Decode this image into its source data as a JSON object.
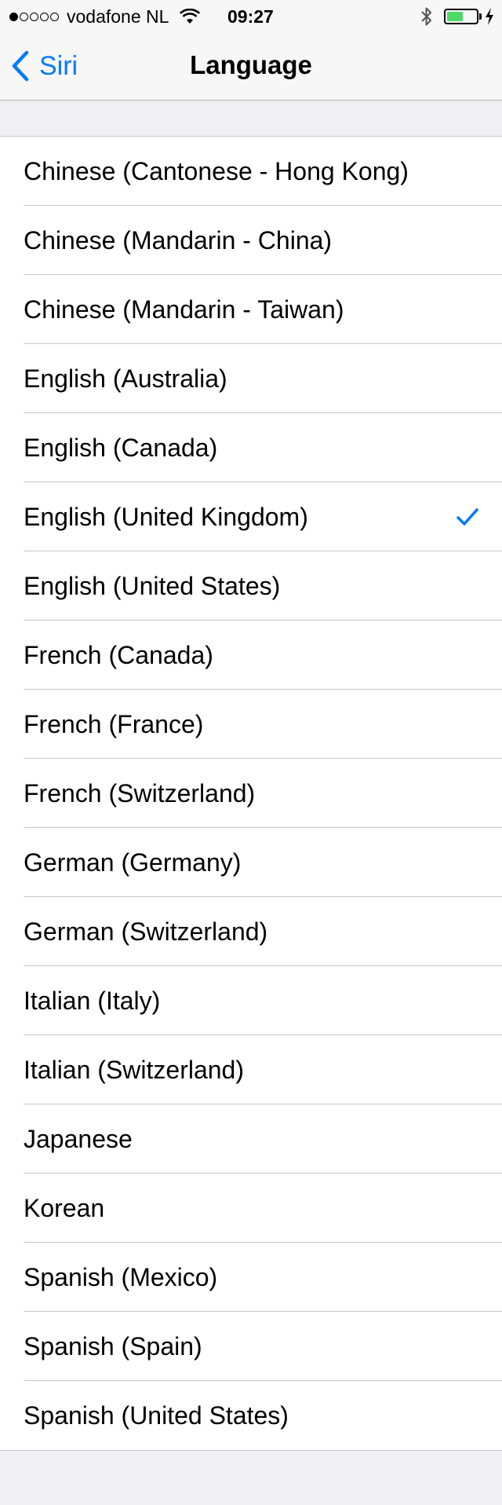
{
  "status_bar": {
    "signal_dots": [
      true,
      false,
      false,
      false,
      false
    ],
    "carrier": "vodafone NL",
    "time": "09:27",
    "battery_level": 0.6,
    "battery_color": "#4cd964"
  },
  "nav": {
    "back_label": "Siri",
    "title": "Language",
    "accent_color": "#007aff"
  },
  "languages": [
    {
      "label": "Chinese (Cantonese - Hong Kong)",
      "selected": false
    },
    {
      "label": "Chinese (Mandarin - China)",
      "selected": false
    },
    {
      "label": "Chinese (Mandarin - Taiwan)",
      "selected": false
    },
    {
      "label": "English (Australia)",
      "selected": false
    },
    {
      "label": "English (Canada)",
      "selected": false
    },
    {
      "label": "English (United Kingdom)",
      "selected": true
    },
    {
      "label": "English (United States)",
      "selected": false
    },
    {
      "label": "French (Canada)",
      "selected": false
    },
    {
      "label": "French (France)",
      "selected": false
    },
    {
      "label": "French (Switzerland)",
      "selected": false
    },
    {
      "label": "German (Germany)",
      "selected": false
    },
    {
      "label": "German (Switzerland)",
      "selected": false
    },
    {
      "label": "Italian (Italy)",
      "selected": false
    },
    {
      "label": "Italian (Switzerland)",
      "selected": false
    },
    {
      "label": "Japanese",
      "selected": false
    },
    {
      "label": "Korean",
      "selected": false
    },
    {
      "label": "Spanish (Mexico)",
      "selected": false
    },
    {
      "label": "Spanish (Spain)",
      "selected": false
    },
    {
      "label": "Spanish (United States)",
      "selected": false
    }
  ]
}
